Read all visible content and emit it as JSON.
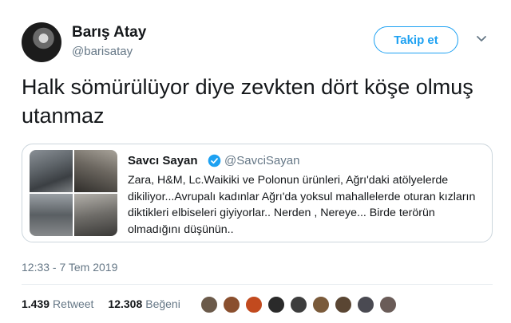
{
  "author": {
    "name": "Barış Atay",
    "handle": "@barisatay"
  },
  "follow_button_label": "Takip et",
  "tweet_text": "Halk sömürülüyor diye zevkten dört köşe olmuş utanmaz",
  "quoted_tweet": {
    "name": "Savcı Sayan",
    "handle": "@SavciSayan",
    "text": "Zara, H&M, Lc.Waikiki ve Polonun ürünleri, Ağrı'daki atölyelerde dikiliyor...Avrupalı kadınlar Ağrı'da yoksul mahallelerde oturan kızların diktikleri elbiseleri giyiyorlar.. Nerden , Nereye... Birde terörün olmadığını düşünün.."
  },
  "timestamp": "12:33 - 7 Tem 2019",
  "stats": {
    "retweets_count": "1.439",
    "retweets_label": "Retweet",
    "likes_count": "12.308",
    "likes_label": "Beğeni"
  },
  "colors": {
    "accent": "#1da1f2",
    "secondary_text": "#657786",
    "border": "#ccd6dd"
  },
  "liker_avatars": [
    {
      "color": "#6b5a4a"
    },
    {
      "color": "#8a4f2e"
    },
    {
      "color": "#c24a1e"
    },
    {
      "color": "#2a2a2a"
    },
    {
      "color": "#3d3d3d"
    },
    {
      "color": "#7a5a3a"
    },
    {
      "color": "#5a4633"
    },
    {
      "color": "#4a4a52"
    },
    {
      "color": "#6a5c58"
    }
  ]
}
